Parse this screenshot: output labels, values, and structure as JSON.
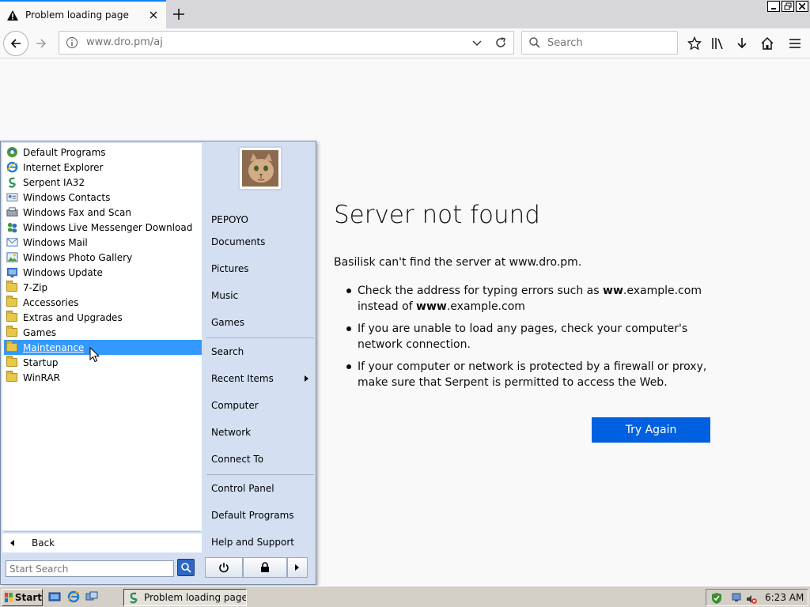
{
  "browser": {
    "tab_title": "Problem loading page",
    "url": "www.dro.pm/aj",
    "search_placeholder": "Search"
  },
  "error_page": {
    "title": "Server not found",
    "description": "Basilisk can't find the server at www.dro.pm.",
    "tips": [
      {
        "pre": "Check the address for typing errors such as ",
        "b1": "ww",
        "mid": ".example.com instead of ",
        "b2": "www",
        "post": ".example.com"
      },
      "If you are unable to load any pages, check your computer's network connection.",
      "If your computer or network is protected by a firewall or proxy, make sure that Serpent is permitted to access the Web."
    ],
    "try_again_label": "Try Again"
  },
  "start_menu": {
    "programs": [
      {
        "label": "Default Programs",
        "icon": "default-programs-icon"
      },
      {
        "label": "Internet Explorer",
        "icon": "internet-explorer-icon"
      },
      {
        "label": "Serpent IA32",
        "icon": "serpent-icon"
      },
      {
        "label": "Windows Contacts",
        "icon": "contacts-icon"
      },
      {
        "label": "Windows Fax and Scan",
        "icon": "fax-icon"
      },
      {
        "label": "Windows Live Messenger Download",
        "icon": "messenger-icon"
      },
      {
        "label": "Windows Mail",
        "icon": "mail-icon"
      },
      {
        "label": "Windows Photo Gallery",
        "icon": "photo-gallery-icon"
      },
      {
        "label": "Windows Update",
        "icon": "windows-update-icon"
      },
      {
        "label": "7-Zip",
        "icon": "folder-icon"
      },
      {
        "label": "Accessories",
        "icon": "folder-icon"
      },
      {
        "label": "Extras and Upgrades",
        "icon": "folder-icon"
      },
      {
        "label": "Games",
        "icon": "folder-icon"
      },
      {
        "label": "Maintenance",
        "icon": "folder-icon",
        "selected": true
      },
      {
        "label": "Startup",
        "icon": "folder-icon"
      },
      {
        "label": "WinRAR",
        "icon": "folder-icon"
      }
    ],
    "back_label": "Back",
    "search_placeholder": "Start Search",
    "right_items": {
      "user": "PEPOYO",
      "documents": "Documents",
      "pictures": "Pictures",
      "music": "Music",
      "games": "Games",
      "search": "Search",
      "recent": "Recent Items",
      "computer": "Computer",
      "network": "Network",
      "connect": "Connect To",
      "control_panel": "Control Panel",
      "default_programs": "Default Programs",
      "help": "Help and Support"
    }
  },
  "taskbar": {
    "start_label": "Start",
    "task_label": "Problem loading page ...",
    "clock": "6:23 AM"
  },
  "colors": {
    "accent": "#0a84ff",
    "button": "#0060df",
    "selection": "#3399ff"
  }
}
